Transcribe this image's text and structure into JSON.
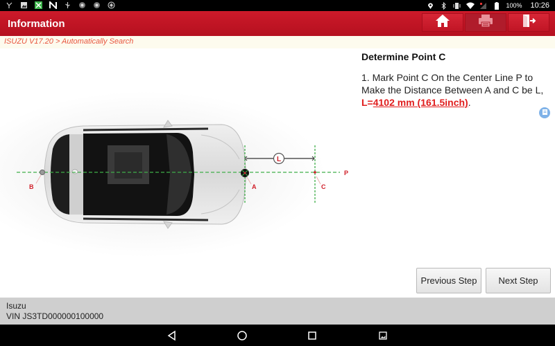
{
  "status_bar": {
    "left_icons": [
      "usb-debug-icon",
      "image-icon",
      "app-icon",
      "n-icon",
      "usb-icon",
      "shield-icon",
      "shield-icon",
      "settings-icon"
    ],
    "right_icons": [
      "location-icon",
      "bluetooth-icon",
      "vibrate-icon",
      "wifi-icon",
      "signal-icon",
      "battery-icon"
    ],
    "battery": "100%",
    "time": "10:26"
  },
  "header": {
    "title": "Information",
    "buttons": [
      {
        "name": "home",
        "icon": "home-icon"
      },
      {
        "name": "print",
        "icon": "printer-icon",
        "disabled": true
      },
      {
        "name": "exit",
        "icon": "exit-icon"
      }
    ]
  },
  "breadcrumb": "ISUZU V17.20 > Automatically Search",
  "diagram": {
    "labels": {
      "b": "B",
      "a": "A",
      "c": "C",
      "p": "P",
      "l": "L"
    },
    "colors": {
      "guide_line": "#3fae49",
      "label": "#d0202a"
    }
  },
  "instructions": {
    "heading": "Determine Point C",
    "body_prefix": "1. Mark Point C On the Center Line P to Make the Distance Between A and C be L, ",
    "highlight_prefix": "L=",
    "highlight_value": "4102 mm (161.5inch)",
    "body_suffix": "."
  },
  "buttons": {
    "previous": "Previous Step",
    "next": "Next Step"
  },
  "footer": {
    "make": "Isuzu",
    "vin": "VIN JS3TD000000100000"
  },
  "nav_bar": [
    "back-icon",
    "home-circle-icon",
    "recents-icon",
    "screenshot-icon"
  ]
}
